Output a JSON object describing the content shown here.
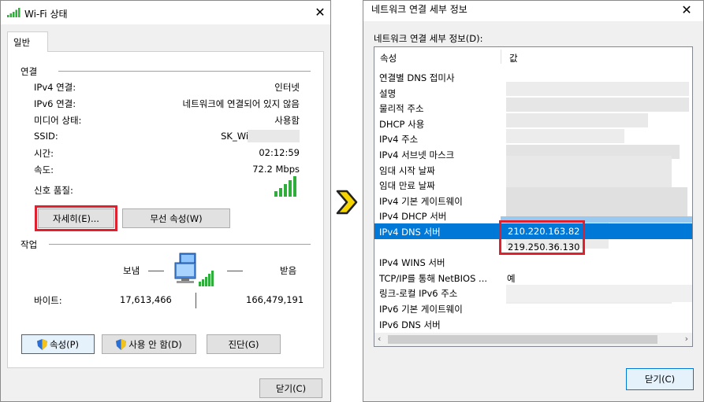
{
  "left_window": {
    "title": "Wi-Fi 상태",
    "tab": "일반",
    "connection_section": "연결",
    "rows": [
      {
        "key": "IPv4 연결:",
        "value": "인터넷"
      },
      {
        "key": "IPv6 연결:",
        "value": "네트워크에 연결되어 있지 않음"
      },
      {
        "key": "미디어 상태:",
        "value": "사용함"
      },
      {
        "key": "SSID:",
        "value": "SK_WiFi"
      },
      {
        "key": "시간:",
        "value": "02:12:59"
      },
      {
        "key": "속도:",
        "value": "72.2 Mbps"
      }
    ],
    "signal_label": "신호 품질:",
    "details_button": "자세히(E)...",
    "wireless_props_button": "무선 속성(W)",
    "activity_section": "작업",
    "sent_label": "보냄",
    "received_label": "받음",
    "bytes_label": "바이트:",
    "bytes_sent": "17,613,466",
    "bytes_received": "166,479,191",
    "properties_button": "속성(P)",
    "disable_button": "사용 안 함(D)",
    "diagnose_button": "진단(G)",
    "close_button": "닫기(C)"
  },
  "right_window": {
    "title": "네트워크 연결 세부 정보",
    "list_label": "네트워크 연결 세부 정보(D):",
    "col_property": "속성",
    "col_value": "값",
    "rows": [
      {
        "key": "연결별 DNS 접미사",
        "value": ""
      },
      {
        "key": "설명",
        "value": ""
      },
      {
        "key": "물리적 주소",
        "value": ""
      },
      {
        "key": "DHCP 사용",
        "value": ""
      },
      {
        "key": "IPv4 주소",
        "value": ""
      },
      {
        "key": "IPv4 서브넷 마스크",
        "value": ""
      },
      {
        "key": "임대 시작 날짜",
        "value": ""
      },
      {
        "key": "임대 만료 날짜",
        "value": ""
      },
      {
        "key": "IPv4 기본 게이트웨이",
        "value": ""
      },
      {
        "key": "IPv4 DHCP 서버",
        "value": ""
      },
      {
        "key": "IPv4 DNS 서버",
        "value": "210.220.163.82",
        "selected": true
      },
      {
        "key": "",
        "value": "219.250.36.130"
      },
      {
        "key": "IPv4 WINS 서버",
        "value": ""
      },
      {
        "key": "TCP/IP를 통해 NetBIOS ...",
        "value": "예"
      },
      {
        "key": "링크-로컬 IPv6 주소",
        "value": ""
      },
      {
        "key": "IPv6 기본 게이트웨이",
        "value": ""
      },
      {
        "key": "IPv6 DNS 서버",
        "value": ""
      }
    ],
    "close_button": "닫기(C)"
  },
  "colors": {
    "highlight": "#e0202e",
    "selection": "#0078d7",
    "arrow": "#f5d400",
    "signal": "#2fae3c"
  }
}
